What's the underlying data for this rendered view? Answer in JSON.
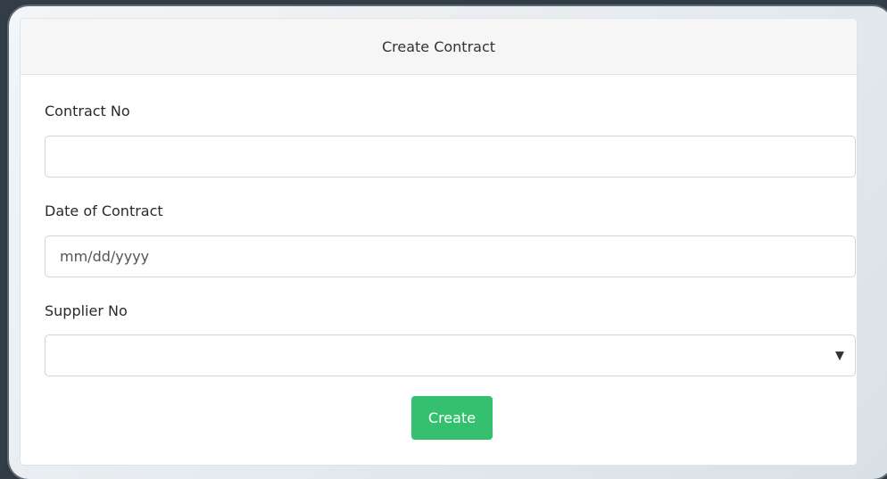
{
  "form": {
    "title": "Create Contract",
    "fields": {
      "contract_no": {
        "label": "Contract No",
        "value": ""
      },
      "date_of_contract": {
        "label": "Date of Contract",
        "placeholder": "mm/dd/yyyy",
        "value": ""
      },
      "supplier_no": {
        "label": "Supplier No",
        "selected": ""
      }
    },
    "submit_label": "Create",
    "arrow_glyph": "▼"
  },
  "colors": {
    "submit_button": "#35c06f",
    "background": "#333d47"
  }
}
